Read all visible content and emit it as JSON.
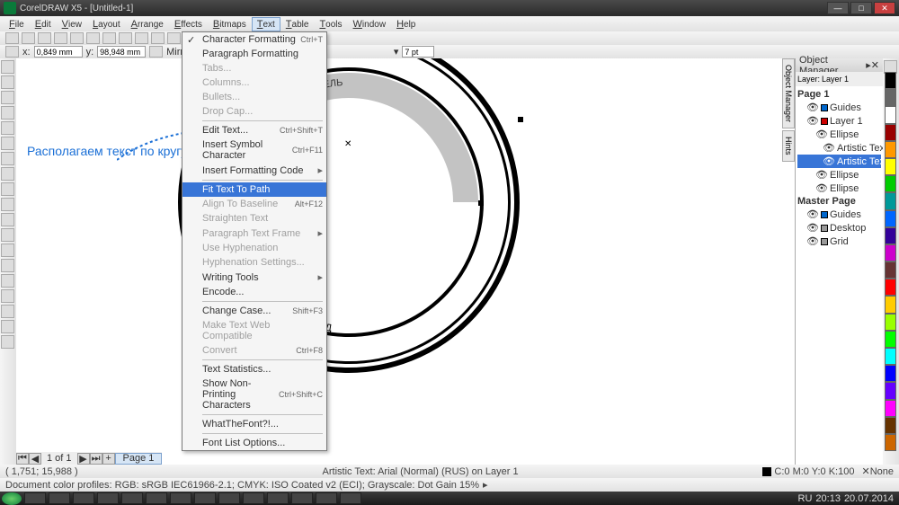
{
  "app": {
    "title": "CorelDRAW X5 - [Untitled-1]"
  },
  "menus": [
    "File",
    "Edit",
    "View",
    "Layout",
    "Arrange",
    "Effects",
    "Bitmaps",
    "Text",
    "Table",
    "Tools",
    "Window",
    "Help"
  ],
  "props": {
    "x": "0,849 mm",
    "y": "98,948 mm",
    "mirror": "Mirror Tex",
    "pt": "7 pt"
  },
  "dropdown": [
    {
      "t": "item",
      "label": "Character Formatting",
      "sh": "Ctrl+T",
      "chk": true
    },
    {
      "t": "item",
      "label": "Paragraph Formatting"
    },
    {
      "t": "item",
      "label": "Tabs...",
      "dis": true
    },
    {
      "t": "item",
      "label": "Columns...",
      "dis": true
    },
    {
      "t": "item",
      "label": "Bullets...",
      "dis": true
    },
    {
      "t": "item",
      "label": "Drop Cap...",
      "dis": true
    },
    {
      "t": "sep"
    },
    {
      "t": "item",
      "label": "Edit Text...",
      "sh": "Ctrl+Shift+T"
    },
    {
      "t": "item",
      "label": "Insert Symbol Character",
      "sh": "Ctrl+F11"
    },
    {
      "t": "item",
      "label": "Insert Formatting Code",
      "arr": true
    },
    {
      "t": "sep"
    },
    {
      "t": "item",
      "label": "Fit Text To Path",
      "sel": true
    },
    {
      "t": "item",
      "label": "Align To Baseline",
      "dis": true,
      "sh": "Alt+F12"
    },
    {
      "t": "item",
      "label": "Straighten Text",
      "dis": true
    },
    {
      "t": "item",
      "label": "Paragraph Text Frame",
      "dis": true,
      "arr": true
    },
    {
      "t": "item",
      "label": "Use Hyphenation",
      "dis": true
    },
    {
      "t": "item",
      "label": "Hyphenation Settings...",
      "dis": true
    },
    {
      "t": "item",
      "label": "Writing Tools",
      "arr": true
    },
    {
      "t": "item",
      "label": "Encode..."
    },
    {
      "t": "sep"
    },
    {
      "t": "item",
      "label": "Change Case...",
      "sh": "Shift+F3"
    },
    {
      "t": "item",
      "label": "Make Text Web Compatible",
      "dis": true
    },
    {
      "t": "item",
      "label": "Convert",
      "dis": true,
      "sh": "Ctrl+F8"
    },
    {
      "t": "sep"
    },
    {
      "t": "item",
      "label": "Text Statistics..."
    },
    {
      "t": "item",
      "label": "Show Non-Printing Characters",
      "sh": "Ctrl+Shift+C"
    },
    {
      "t": "sep"
    },
    {
      "t": "item",
      "label": "WhatTheFont?!..."
    },
    {
      "t": "sep"
    },
    {
      "t": "item",
      "label": "Font List Options..."
    }
  ],
  "annotation": "Располагаем текст по кругу",
  "stamp": {
    "top": "Й ПРЕДПРИНИМАТЕЛЬ",
    "bottom": "ГОРОД НИЖНИЙ НОВГОРОД"
  },
  "objmgr": {
    "title": "Object Manager",
    "layerinfo": "Layer:",
    "layername": "Layer 1",
    "tree": [
      {
        "l": "Page 1",
        "lvl": 0,
        "bold": true
      },
      {
        "l": "Guides",
        "lvl": 1,
        "c": "sqb"
      },
      {
        "l": "Layer 1",
        "lvl": 1,
        "c": "sq"
      },
      {
        "l": "Ellipse",
        "lvl": 2
      },
      {
        "l": "Artistic Text: Ari",
        "lvl": 3
      },
      {
        "l": "Artistic Text: Ari",
        "lvl": 3,
        "sel": true
      },
      {
        "l": "Ellipse",
        "lvl": 2
      },
      {
        "l": "Ellipse",
        "lvl": 2
      },
      {
        "l": "Master Page",
        "lvl": 0,
        "bold": true
      },
      {
        "l": "Guides",
        "lvl": 1,
        "c": "sqb"
      },
      {
        "l": "Desktop",
        "lvl": 1,
        "c": "sqg"
      },
      {
        "l": "Grid",
        "lvl": 1,
        "c": "sqg"
      }
    ]
  },
  "nav": {
    "pages": "1 of 1",
    "pagetab": "Page 1"
  },
  "status": {
    "coords": "( 1,751; 15,988 )",
    "obj": "Artistic Text: Arial (Normal) (RUS) on Layer 1",
    "fill": "C:0 M:0 Y:0 K:100",
    "outline": "None"
  },
  "profile": "Document color profiles: RGB: sRGB IEC61966-2.1; CMYK: ISO Coated v2 (ECI); Grayscale: Dot Gain 15%",
  "ruler_unit": "millimeters",
  "tray": {
    "time": "20:13",
    "date": "20.07.2014",
    "lang": "RU"
  },
  "colors": [
    "#000",
    "#666",
    "#fff",
    "#900",
    "#f90",
    "#ff0",
    "#0c0",
    "#099",
    "#06f",
    "#309",
    "#c0c",
    "#633",
    "#f00",
    "#fc0",
    "#9f0",
    "#0f0",
    "#0ff",
    "#00f",
    "#60f",
    "#f0f",
    "#630",
    "#c60"
  ]
}
